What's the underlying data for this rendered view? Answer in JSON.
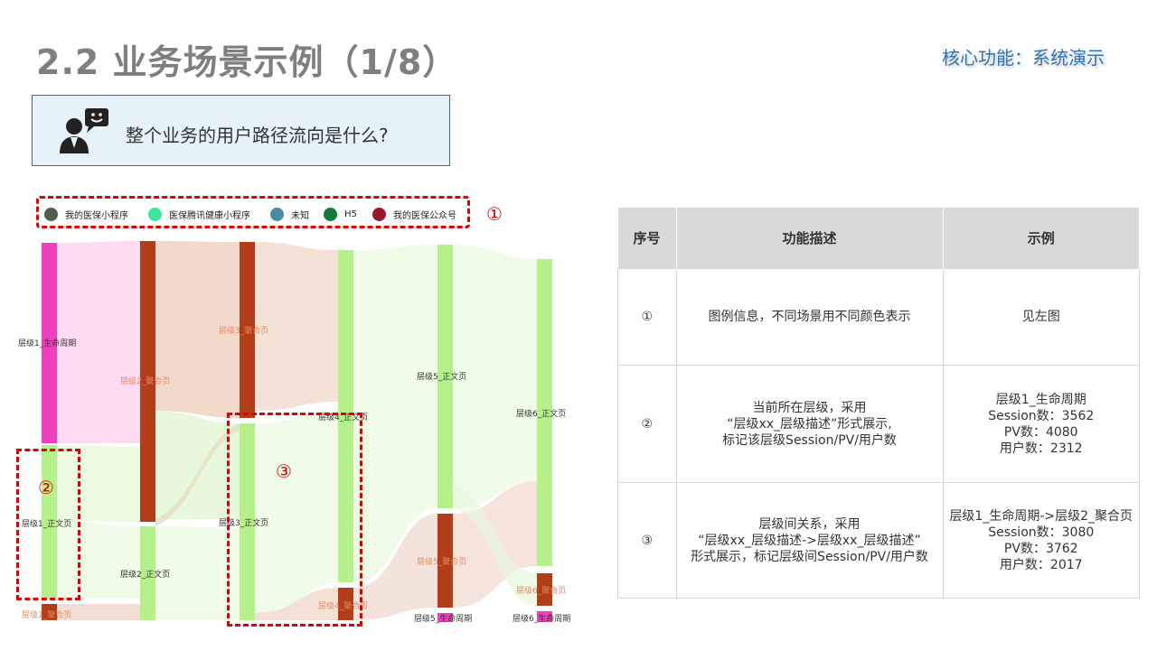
{
  "header": {
    "title": "2.2 业务场景示例（1/8）",
    "subtitle": "核心功能：系统演示"
  },
  "question": {
    "text": "整个业务的用户路径流向是什么?"
  },
  "legend": {
    "items": [
      {
        "label": "我的医保小程序",
        "color": "#4f5f4a"
      },
      {
        "label": "医保腾讯健康小程序",
        "color": "#3de59e"
      },
      {
        "label": "未知",
        "color": "#4a8aa6"
      },
      {
        "label": "H5",
        "color": "#127a3a"
      },
      {
        "label": "我的医保公众号",
        "color": "#99192c"
      }
    ]
  },
  "annotations": {
    "m1": "①",
    "m2": "②",
    "m3": "③"
  },
  "sankey": {
    "labels": {
      "l1_life": "层级1_生命周期",
      "l1_text": "层级1_正文页",
      "l1_agg": "层级1_聚合页",
      "l2_agg": "层级2_聚合页",
      "l2_text": "层级2_正文页",
      "l3_agg": "层级3_聚合页",
      "l3_text": "层级3_正文页",
      "l4_text": "层级4_正文页",
      "l4_agg": "层级4_聚合页",
      "l5_text": "层级5_正文页",
      "l5_agg": "层级5_聚合页",
      "l5_life": "层级5_生命周期",
      "l6_text": "层级6_正文页",
      "l6_agg": "层级6_聚合页",
      "l6_life": "层级6_生命周期"
    },
    "colors": {
      "pink": "#ef3fbf",
      "green": "#b5f08a",
      "brown": "#b23e19"
    }
  },
  "table": {
    "headers": [
      "序号",
      "功能描述",
      "示例"
    ],
    "rows": [
      {
        "num": "①",
        "desc": [
          "图例信息，不同场景用不同颜色表示"
        ],
        "example": [
          "见左图"
        ]
      },
      {
        "num": "②",
        "desc": [
          "当前所在层级，采用",
          "“层级xx_层级描述”形式展示,",
          "标记该层级Session/PV/用户数"
        ],
        "example": [
          "层级1_生命周期",
          "Session数：3562",
          "PV数：4080",
          "用户数：2312"
        ]
      },
      {
        "num": "③",
        "desc": [
          "层级间关系，采用",
          "“层级xx_层级描述->层级xx_层级描述”",
          "形式展示，标记层级间Session/PV/用户数"
        ],
        "example": [
          "层级1_生命周期->层级2_聚合页",
          "Session数：3080",
          "PV数：3762",
          "用户数：2017"
        ]
      }
    ]
  }
}
